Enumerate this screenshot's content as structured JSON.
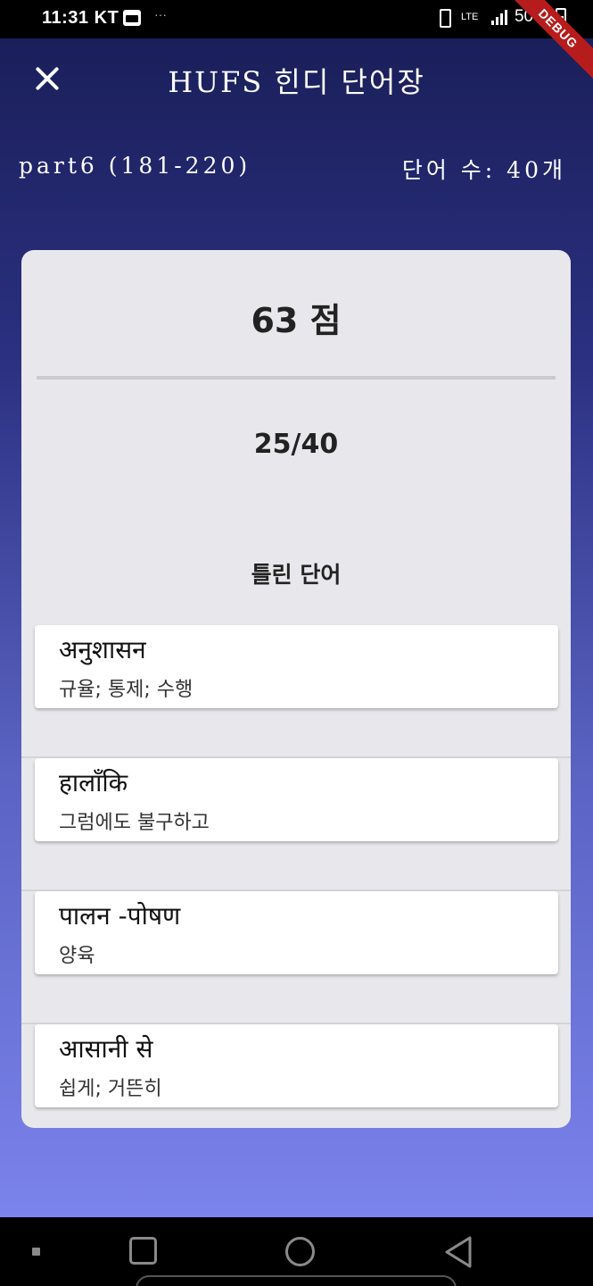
{
  "status_bar": {
    "time": "11:31",
    "carrier": "KT",
    "more": "···",
    "network": "LTE",
    "battery": "50%",
    "debug_label": "DEBUG"
  },
  "app_bar": {
    "close_icon": "close-icon",
    "title": "HUFS 힌디 단어장"
  },
  "info": {
    "part": "part6 (181-220)",
    "word_count": "단어 수: 40개"
  },
  "result": {
    "score": "63 점",
    "ratio": "25/40",
    "wrong_title": "틀린 단어"
  },
  "wrong_words": [
    {
      "hindi": "अनुशासन",
      "meaning": "규율; 통제; 수행"
    },
    {
      "hindi": "हालाँकि",
      "meaning": "그럼에도 불구하고"
    },
    {
      "hindi": "पालन -पोषण",
      "meaning": "양육"
    },
    {
      "hindi": "आसानी से",
      "meaning": "쉽게; 거뜬히"
    }
  ],
  "nav_bar": {
    "icons": [
      "recent-apps-icon",
      "home-icon",
      "back-icon"
    ]
  },
  "colors": {
    "gradient_top": "#1a1f5a",
    "gradient_bottom": "#7b83ec",
    "card_bg": "#e8e8ec",
    "debug_banner": "#b71c1c"
  }
}
